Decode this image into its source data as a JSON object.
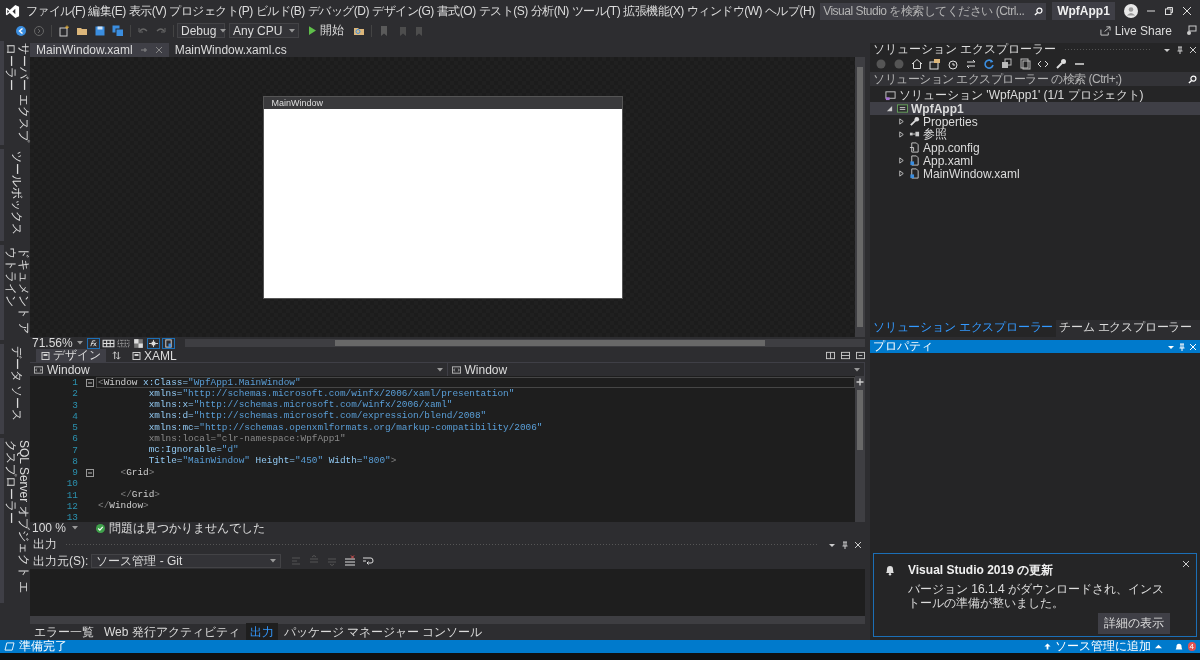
{
  "window": {
    "title": "WpfApp1",
    "search": {
      "placeholder": "Visual Studio を検索してください (Ctrl..."
    }
  },
  "menu": [
    "ファイル(F)",
    "編集(E)",
    "表示(V)",
    "プロジェクト(P)",
    "ビルド(B)",
    "デバッグ(D)",
    "デザイン(G)",
    "書式(O)",
    "テスト(S)",
    "分析(N)",
    "ツール(T)",
    "拡張機能(X)",
    "ウィンドウ(W)",
    "ヘルプ(H)"
  ],
  "toolbar": {
    "configuration": "Debug",
    "platform": "Any CPU",
    "start": "開始",
    "live_share": "Live Share"
  },
  "side_tabs": [
    "サーバー エクスプローラー",
    "ツールボックス",
    "ドキュメント アウトライン",
    "データ ソース",
    "SQL Server オブジェクト エクスプローラー"
  ],
  "document_tabs": [
    {
      "label": "MainWindow.xaml",
      "selected": true
    },
    {
      "label": "MainWindow.xaml.cs",
      "selected": false
    }
  ],
  "designer": {
    "window_title": "MainWindow",
    "zoom": "71.56%",
    "view_tabs": [
      {
        "label": "デザイン",
        "selected": true
      },
      {
        "label": "XAML",
        "selected": false
      }
    ],
    "nav": [
      "Window",
      "Window"
    ]
  },
  "code": {
    "lines": [
      {
        "number": "1",
        "fold": true,
        "current": true,
        "unused": false,
        "text": "<Window x:Class=\"WpfApp1.MainWindow\""
      },
      {
        "number": "2",
        "fold": false,
        "current": false,
        "unused": false,
        "text": "         xmlns=\"http://schemas.microsoft.com/winfx/2006/xaml/presentation\""
      },
      {
        "number": "3",
        "fold": false,
        "current": false,
        "unused": false,
        "text": "         xmlns:x=\"http://schemas.microsoft.com/winfx/2006/xaml\""
      },
      {
        "number": "4",
        "fold": false,
        "current": false,
        "unused": false,
        "text": "         xmlns:d=\"http://schemas.microsoft.com/expression/blend/2008\""
      },
      {
        "number": "5",
        "fold": false,
        "current": false,
        "unused": false,
        "text": "         xmlns:mc=\"http://schemas.openxmlformats.org/markup-compatibility/2006\""
      },
      {
        "number": "6",
        "fold": false,
        "current": false,
        "unused": true,
        "text": "         xmlns:local=\"clr-namespace:WpfApp1\""
      },
      {
        "number": "7",
        "fold": false,
        "current": false,
        "unused": false,
        "text": "         mc:Ignorable=\"d\""
      },
      {
        "number": "8",
        "fold": false,
        "current": false,
        "unused": false,
        "text": "         Title=\"MainWindow\" Height=\"450\" Width=\"800\">"
      },
      {
        "number": "9",
        "fold": true,
        "current": false,
        "unused": false,
        "text": "    <Grid>"
      },
      {
        "number": "10",
        "fold": false,
        "current": false
      },
      {
        "number": "11",
        "fold": false,
        "current": false,
        "unused": false,
        "text": "    </Grid>"
      },
      {
        "number": "12",
        "fold": false,
        "current": false,
        "unused": false,
        "text": "</Window>"
      },
      {
        "number": "13",
        "fold": false,
        "current": false
      }
    ]
  },
  "editor_status": {
    "zoom": "100 %",
    "message": "問題は見つかりませんでした"
  },
  "output": {
    "title": "出力",
    "source_label": "出力元(S):",
    "source": "ソース管理 - Git",
    "tabs": [
      {
        "label": "エラー一覧",
        "selected": false
      },
      {
        "label": "Web 発行アクティビティ",
        "selected": false
      },
      {
        "label": "出力",
        "selected": true
      },
      {
        "label": "パッケージ マネージャー コンソール",
        "selected": false
      }
    ]
  },
  "solution_explorer": {
    "title": "ソリューション エクスプローラー",
    "search": {
      "placeholder": "ソリューション エクスプローラー の検索 (Ctrl+;)"
    },
    "tree": [
      {
        "label": "ソリューション 'WpfApp1' (1/1 プロジェクト)",
        "kind": "solution",
        "selected": false,
        "children": [
          {
            "label": "WpfApp1",
            "kind": "project",
            "selected": true,
            "expanded": true,
            "children": [
              {
                "label": "Properties",
                "kind": "properties",
                "selected": false,
                "expanded": false
              },
              {
                "label": "参照",
                "kind": "references",
                "selected": false,
                "expanded": false
              },
              {
                "label": "App.config",
                "kind": "config",
                "selected": false
              },
              {
                "label": "App.xaml",
                "kind": "xaml",
                "selected": false,
                "expanded": false
              },
              {
                "label": "MainWindow.xaml",
                "kind": "xaml",
                "selected": false,
                "expanded": false
              }
            ]
          }
        ]
      }
    ],
    "tabs": [
      {
        "label": "ソリューション エクスプローラー",
        "selected": true
      },
      {
        "label": "チーム エクスプローラー",
        "selected": false
      }
    ]
  },
  "properties": {
    "title": "プロパティ"
  },
  "notification": {
    "title": "Visual Studio 2019 の更新",
    "message": "バージョン 16.1.4 がダウンロードされ、インストールの準備が整いました。",
    "button": "詳細の表示"
  },
  "status_bar": {
    "text": "準備完了",
    "source_control": "ソース管理に追加",
    "notifications": "4"
  }
}
